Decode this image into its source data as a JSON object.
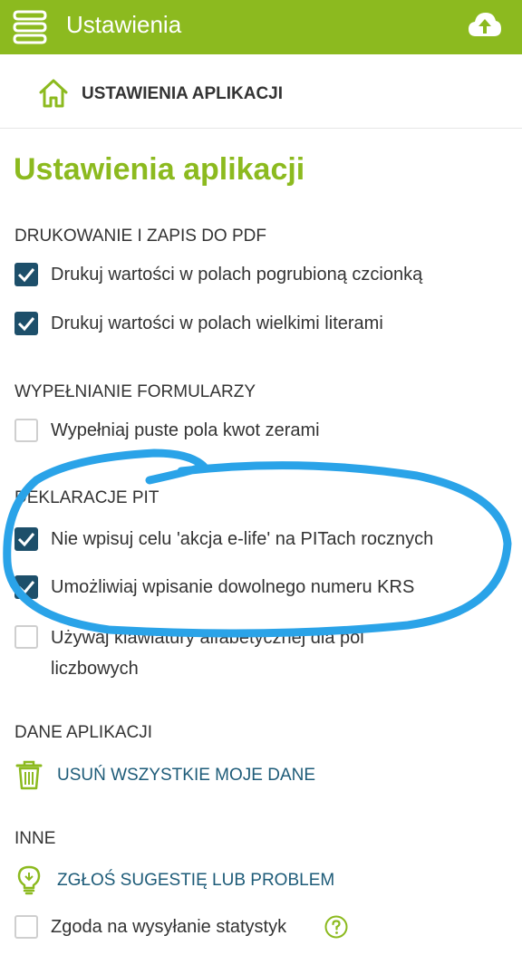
{
  "topbar": {
    "title": "Ustawienia",
    "color": "#8cba1f",
    "menu_icon": "menu-icon",
    "cloud_icon": "cloud-upload-icon"
  },
  "breadcrumb": {
    "icon": "home-icon",
    "label": "USTAWIENIA APLIKACJI"
  },
  "page_title": "Ustawienia aplikacji",
  "sections": {
    "printing": {
      "header": "DRUKOWANIE I ZAPIS DO PDF",
      "options": [
        {
          "label": "Drukuj wartości w polach pogrubioną czcionką",
          "checked": true
        },
        {
          "label": "Drukuj wartości w polach wielkimi literami",
          "checked": true
        }
      ]
    },
    "forms": {
      "header": "WYPEŁNIANIE FORMULARZY",
      "options": [
        {
          "label": "Wypełniaj puste pola kwot zerami",
          "checked": false
        }
      ]
    },
    "pit": {
      "header": "DEKLARACJE PIT",
      "options": [
        {
          "label": "Nie wpisuj celu 'akcja e-life' na PITach rocznych",
          "checked": true
        },
        {
          "label": "Umożliwiaj wpisanie dowolnego numeru KRS",
          "checked": true
        },
        {
          "label": "Używaj klawiatury alfabetycznej dla pól liczbowych",
          "checked": false
        }
      ]
    },
    "app_data": {
      "header": "DANE APLIKACJI",
      "link": {
        "label": "USUŃ WSZYSTKIE MOJE DANE",
        "icon": "trash-icon"
      }
    },
    "other": {
      "header": "INNE",
      "link": {
        "label": "ZGŁOŚ SUGESTIĘ LUB PROBLEM",
        "icon": "lightbulb-icon"
      },
      "options": [
        {
          "label": "Zgoda na wysyłanie statystyk",
          "checked": false,
          "icon": "help-icon"
        }
      ]
    }
  },
  "colors": {
    "accent": "#8cba1f",
    "checkbox": "#1d4f6a",
    "link": "#1d5b78",
    "annotation": "#2aa3e8"
  }
}
